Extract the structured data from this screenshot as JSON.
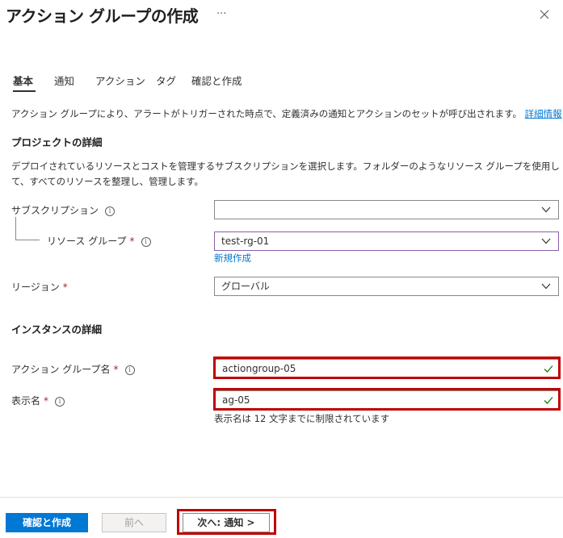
{
  "header": {
    "title": "アクション グループの作成",
    "more": "···"
  },
  "tabs": [
    {
      "label": "基本"
    },
    {
      "label": "通知"
    },
    {
      "label": "アクション"
    },
    {
      "label": "タグ"
    },
    {
      "label": "確認と作成"
    }
  ],
  "intro": {
    "text": "アクション グループにより、アラートがトリガーされた時点で、定義済みの通知とアクションのセットが呼び出されます。",
    "link": "詳細情報"
  },
  "project": {
    "heading": "プロジェクトの詳細",
    "description": "デプロイされているリソースとコストを管理するサブスクリプションを選択します。フォルダーのようなリソース グループを使用して、すべてのリソースを整理し、管理します。",
    "subscription_label": "サブスクリプション",
    "subscription_value": "",
    "rg_label": "リソース グループ",
    "rg_value": "test-rg-01",
    "rg_create_new": "新規作成",
    "region_label": "リージョン",
    "region_value": "グローバル",
    "required_mark": "*"
  },
  "instance": {
    "heading": "インスタンスの詳細",
    "name_label": "アクション グループ名",
    "name_value": "actiongroup-05",
    "display_label": "表示名",
    "display_value": "ag-05",
    "display_hint": "表示名は 12 文字までに制限されています"
  },
  "footer": {
    "review_label": "確認と作成",
    "prev_label": "前へ",
    "next_label": "次へ: 通知 >"
  },
  "colors": {
    "accent": "#0078d4",
    "highlight": "#c00000",
    "valid": "#107c10",
    "required": "#a4262c"
  },
  "icons": [
    "more-icon",
    "close-icon",
    "info-icon",
    "chevron-down-icon",
    "checkmark-icon"
  ]
}
